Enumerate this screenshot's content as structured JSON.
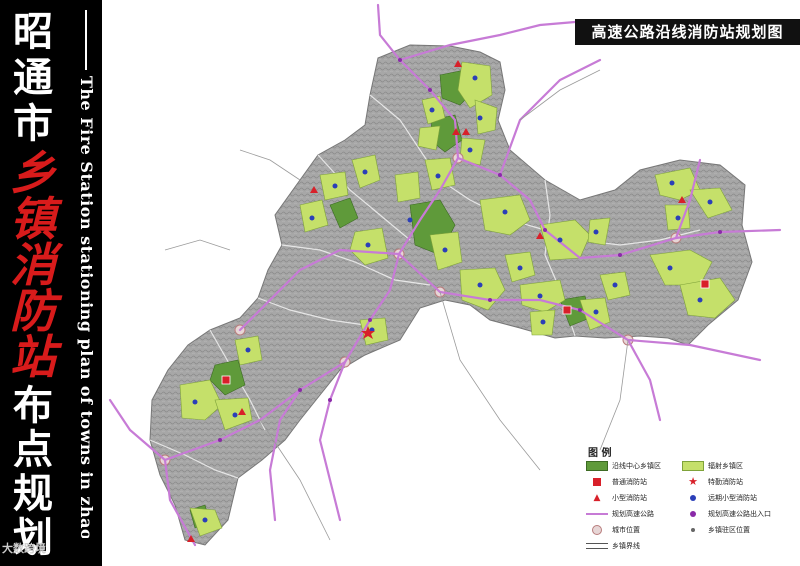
{
  "sidebar": {
    "title_chars": [
      "昭",
      "通",
      "市"
    ],
    "red_chars": [
      "乡",
      "镇",
      "消",
      "防",
      "站"
    ],
    "bottom_chars": [
      "布",
      "点",
      "规",
      "划"
    ],
    "english_title": "The Fire Station stationing plan of towns in zhaotongshi area"
  },
  "map_title": "高速公路沿线消防站规划图",
  "legend": {
    "title": "图 例",
    "items": [
      {
        "symbol": "dark-green-zone",
        "label": "沿线中心乡镇区"
      },
      {
        "symbol": "light-green-zone",
        "label": "辐射乡镇区"
      },
      {
        "symbol": "red-square",
        "label": "普通消防站"
      },
      {
        "symbol": "red-star",
        "label": "特勤消防站"
      },
      {
        "symbol": "red-triangle",
        "label": "小型消防站"
      },
      {
        "symbol": "blue-dot",
        "label": "远期小型消防站"
      },
      {
        "symbol": "purple-line",
        "label": "规划高速公路"
      },
      {
        "symbol": "purple-dot",
        "label": "规划高速公路出入口"
      },
      {
        "symbol": "city-circle",
        "label": "城市位置"
      },
      {
        "symbol": "small-dot",
        "label": "乡镇驻区位置"
      },
      {
        "symbol": "double-line",
        "label": "乡镇界线"
      }
    ]
  },
  "colors": {
    "dark_green": "#5f9a3a",
    "light_green": "#c5e06a",
    "highway": "#c77bd6",
    "station_red": "#d8202a",
    "future_blue": "#2b3fb8",
    "terrain": "#9c9c9c"
  },
  "watermark": "大数跨境"
}
